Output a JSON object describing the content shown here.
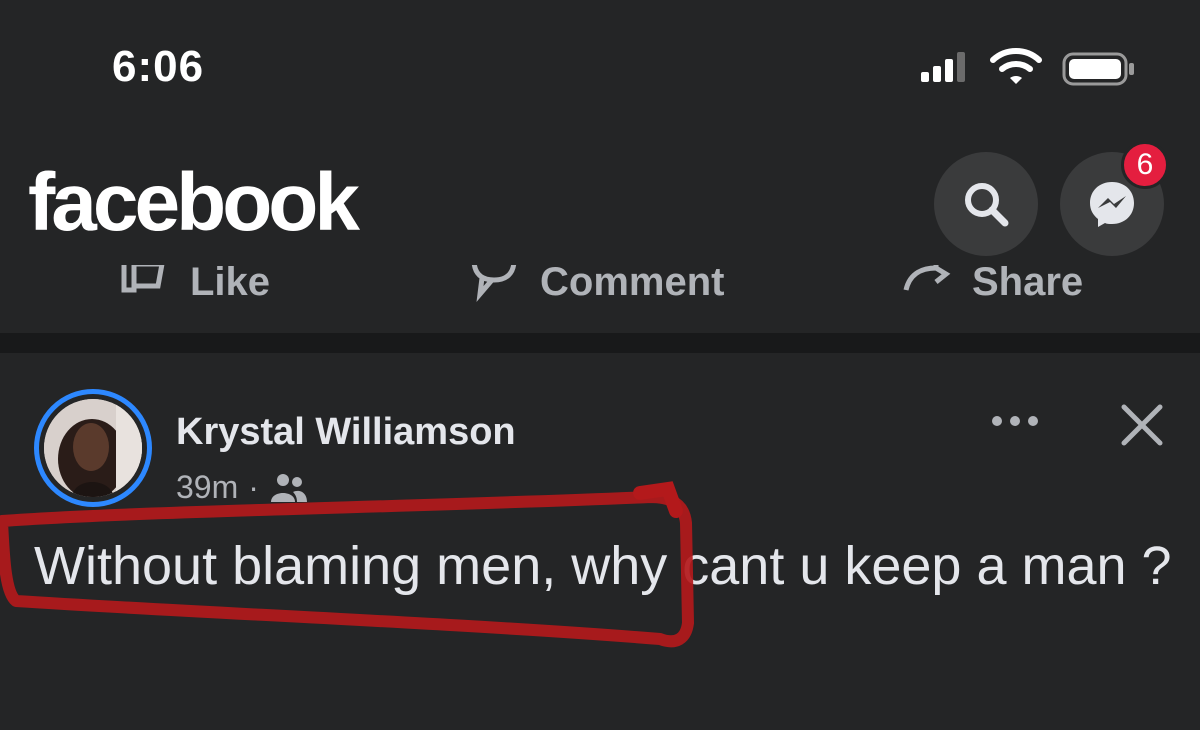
{
  "status_bar": {
    "time": "6:06",
    "icons": [
      "cellular-signal-icon",
      "wifi-icon",
      "battery-icon"
    ]
  },
  "header": {
    "brand": "facebook",
    "search_icon": "search-icon",
    "messenger_icon": "messenger-icon",
    "messenger_badge": "6"
  },
  "previous_post_actions": {
    "like": "Like",
    "comment": "Comment",
    "share": "Share"
  },
  "post": {
    "author": "Krystal Williamson",
    "time": "39m",
    "separator": "·",
    "audience_icon": "friends-icon",
    "text": "Without blaming men, why cant u keep a man ?"
  },
  "colors": {
    "background": "#242526",
    "divider": "#18191a",
    "text": "#e4e6eb",
    "secondary_text": "#b0b3b8",
    "badge": "#e41e3f",
    "avatar_ring": "#2d88ff",
    "annotation": "#b3191b"
  }
}
